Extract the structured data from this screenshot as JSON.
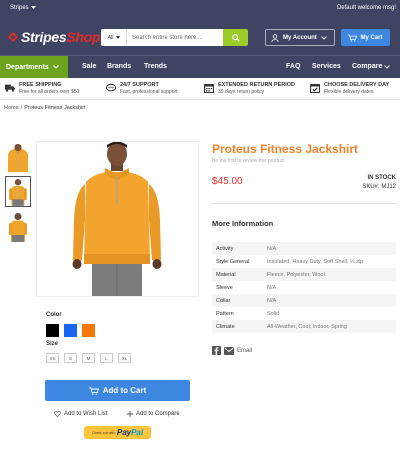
{
  "topbar": {
    "store_switcher": "Stripes",
    "welcome": "Default welcome msg!"
  },
  "brand": {
    "name_part1": "Stripes",
    "name_part2": "Shop"
  },
  "search": {
    "category": "All",
    "placeholder": "Search entire store here..."
  },
  "account": {
    "label": "My Account"
  },
  "cart": {
    "label": "My Cart"
  },
  "nav": {
    "departments": "Departments",
    "links": [
      "Sale",
      "Brands",
      "Trends"
    ],
    "right_links": [
      "FAQ",
      "Services",
      "Compare"
    ]
  },
  "features": [
    {
      "title": "FREE SHIPPING",
      "subtitle": "Free for all orders over $50",
      "icon": "truck-icon"
    },
    {
      "title": "24/7 SUPPORT",
      "subtitle": "Fast, professional support",
      "icon": "chat-icon"
    },
    {
      "title": "EXTENDED RETURN PERIOD",
      "subtitle": "30 days return policy",
      "icon": "calendar-icon"
    },
    {
      "title": "CHOOSE DELIVERY DAY",
      "subtitle": "Flexible delivery dates",
      "icon": "calendar-check-icon"
    }
  ],
  "breadcrumb": {
    "home": "Home",
    "separator": "/",
    "current": "Proteus Fitness Jackshirt"
  },
  "product": {
    "title": "Proteus Fitness Jackshirt",
    "review_link": "Be the first to review this product",
    "price": "$45.00",
    "stock": "IN STOCK",
    "sku_label": "SKU#:",
    "sku": "MJ12",
    "color_label": "Color",
    "colors": [
      "#000000",
      "#1a66f0",
      "#f5780a"
    ],
    "size_label": "Size",
    "sizes": [
      "XS",
      "S",
      "M",
      "L",
      "XL"
    ],
    "add_to_cart": "Add to Cart",
    "wishlist": "Add to Wish List",
    "compare": "Add to Compare",
    "paypal_small": "Check out with",
    "paypal_brand_1": "Pay",
    "paypal_brand_2": "Pal"
  },
  "more_info": {
    "heading": "More Information",
    "rows": [
      {
        "label": "Activity",
        "value": "N/A"
      },
      {
        "label": "Style General",
        "value": "Insulated, Heavy Duty, Soft Shell, ¼ zip"
      },
      {
        "label": "Material",
        "value": "Fleece, Polyester, Wool"
      },
      {
        "label": "Sleeve",
        "value": "N/A"
      },
      {
        "label": "Collar",
        "value": "N/A"
      },
      {
        "label": "Pattern",
        "value": "Solid"
      },
      {
        "label": "Climate",
        "value": "All-Weather, Cool, Indoor, Spring"
      }
    ]
  },
  "share": {
    "email_label": "Email"
  },
  "colors": {
    "header_bg": "#3f4462",
    "accent_green": "#6ea41d",
    "cart_blue": "#3d87e0",
    "title_orange": "#f0812a",
    "price_red": "#e02b27"
  }
}
